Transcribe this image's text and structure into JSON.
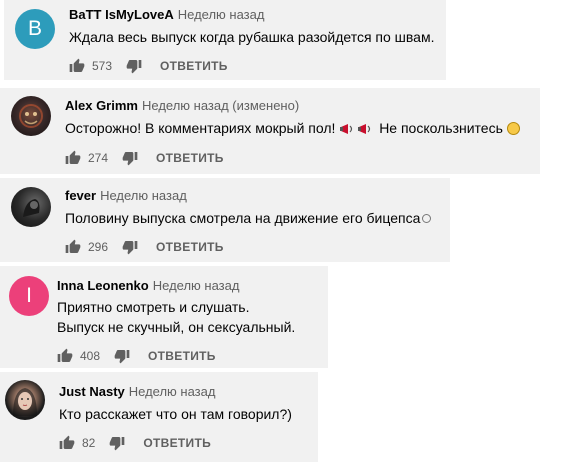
{
  "reply_label": "ОТВЕТИТЬ",
  "comments": [
    {
      "author": "BaTT IsMyLoveA",
      "time": "Неделю назад",
      "text_lines": [
        "Ждала весь выпуск когда рубашка разойдется по швам."
      ],
      "likes": "573",
      "avatar": {
        "type": "letter",
        "letter": "B",
        "color": "#2d9cbb"
      }
    },
    {
      "author": "Alex Grimm",
      "time": "Неделю назад (изменено)",
      "text_lines": [
        "Осторожно! В комментариях мокрый пол!",
        "Не поскользнитесь"
      ],
      "likes": "274",
      "avatar": {
        "type": "image",
        "color": "#3a2a2a"
      }
    },
    {
      "author": "fever",
      "time": "Неделю назад",
      "text_lines": [
        "Половину выпуска смотрела на движение его бицепса"
      ],
      "likes": "296",
      "avatar": {
        "type": "image",
        "color": "#222222"
      }
    },
    {
      "author": "Inna Leonenko",
      "time": "Неделю назад",
      "text_lines": [
        "Приятно смотреть и слушать.",
        "Выпуск не скучный, он сексуальный."
      ],
      "likes": "408",
      "avatar": {
        "type": "letter",
        "letter": "I",
        "color": "#ec407a"
      }
    },
    {
      "author": "Just Nasty",
      "time": "Неделю назад",
      "text_lines": [
        "Кто расскажет что он там говорил?)"
      ],
      "likes": "82",
      "avatar": {
        "type": "image",
        "color": "#2b2b2b"
      }
    }
  ]
}
